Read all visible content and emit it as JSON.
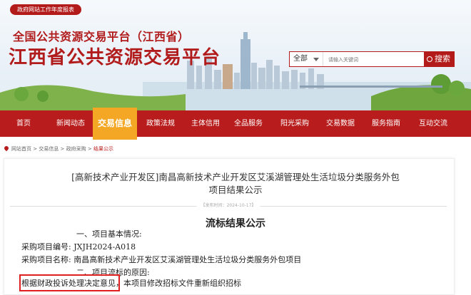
{
  "header": {
    "report_tag": "政府网站工作年度报表",
    "logo_line1": "全国公共资源交易平台（江西省）",
    "logo_line2": "江西省公共资源交易平台"
  },
  "search": {
    "select_value": "全部",
    "placeholder": "请输入关键词",
    "button_label": "搜索"
  },
  "nav": {
    "items": [
      "首页",
      "新闻动态",
      "交易信息",
      "政策法规",
      "主体信用",
      "全品服务",
      "阳光采购",
      "交易数据",
      "服务指南",
      "互动交流"
    ],
    "active": "交易信息"
  },
  "breadcrumb": {
    "items": [
      "网站首页",
      "交易信息",
      "政府采购"
    ],
    "current": "结果公示"
  },
  "article": {
    "title_line1": "[高新技术产业开发区]南昌高新技术产业开发区艾溪湖管理处生活垃圾分类服务外包",
    "title_line2": "项目结果公示",
    "date": "2024-10-17",
    "doc_heading": "流标结果公示",
    "section1": "一、项目基本情况:",
    "project_no_label": "采购项目编号:",
    "project_no": "JXJH2024-A018",
    "project_name_label": "采购项目名称:",
    "project_name": "南昌高新技术产业开发区艾溪湖管理处生活垃圾分类服务外包项目",
    "section2": "二、项目流标的原因:",
    "reason_highlight": "根据财政投诉处理决定意见，",
    "reason_rest": "本项目修改招标文件重新组织招标"
  },
  "colors": {
    "brand_red": "#b81c1c",
    "active_nav": "#f4a724"
  }
}
